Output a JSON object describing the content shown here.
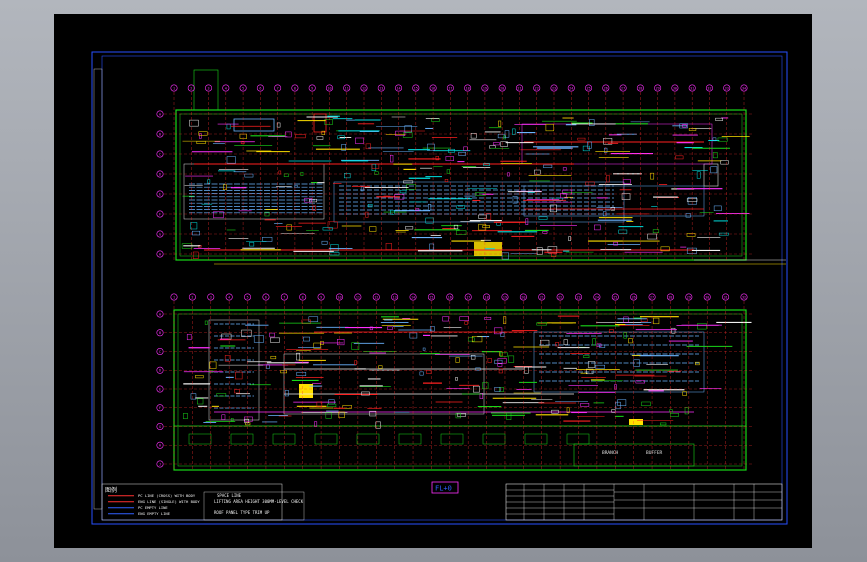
{
  "drawing": {
    "legend_title": "图例",
    "legend_items": [
      {
        "text": "PC LINE (CROSS) WITH BODY",
        "color": "#ff3030"
      },
      {
        "text": "ENG LINE (SINGLE) WITH BODY",
        "color": "#ff3030"
      },
      {
        "text": "PC EMPTY LINE",
        "color": "#3060ff"
      },
      {
        "text": "ENG EMPTY LINE",
        "color": "#3060ff"
      }
    ],
    "notes": [
      "SPACE LINE",
      "LIFTING AREA HEIGHT 300MM-LEVEL CHECK",
      "ROOF PANEL TYPE TRIM UP"
    ],
    "floor_label": "FL+0",
    "column_axis_labels": [
      "1",
      "2",
      "3",
      "4",
      "5",
      "6",
      "7",
      "8",
      "9",
      "10",
      "11",
      "12",
      "13",
      "14",
      "15",
      "16",
      "17",
      "18",
      "19",
      "20",
      "21",
      "22",
      "23",
      "24",
      "25",
      "26",
      "27",
      "28",
      "29",
      "30",
      "31",
      "32",
      "33",
      "34"
    ],
    "lower_column_labels": [
      "1",
      "2",
      "3",
      "4",
      "5",
      "6",
      "7",
      "8",
      "9",
      "10",
      "11",
      "12",
      "13",
      "14",
      "15",
      "16",
      "17",
      "18",
      "19",
      "20",
      "21",
      "22",
      "23",
      "24",
      "25",
      "26",
      "27",
      "28",
      "29",
      "30",
      "31",
      "32"
    ],
    "row_axis_labels": [
      "A",
      "B",
      "C",
      "D",
      "E",
      "F",
      "G",
      "H"
    ],
    "lower_row_labels": [
      "A",
      "B",
      "C",
      "D",
      "E",
      "F",
      "G",
      "H",
      "J"
    ],
    "zone_label_left": "BRANCH",
    "zone_label_right": "BUFFER"
  },
  "colors": {
    "background": "#000000",
    "frame": "#2850ff",
    "wall": "#18d818",
    "conveyor_red": "#ff2020",
    "conveyor_blue": "#6ab4ff",
    "magenta": "#ff30ff",
    "yellow": "#ffe000",
    "white": "#f0f0f0",
    "cyan": "#00e0e0"
  }
}
